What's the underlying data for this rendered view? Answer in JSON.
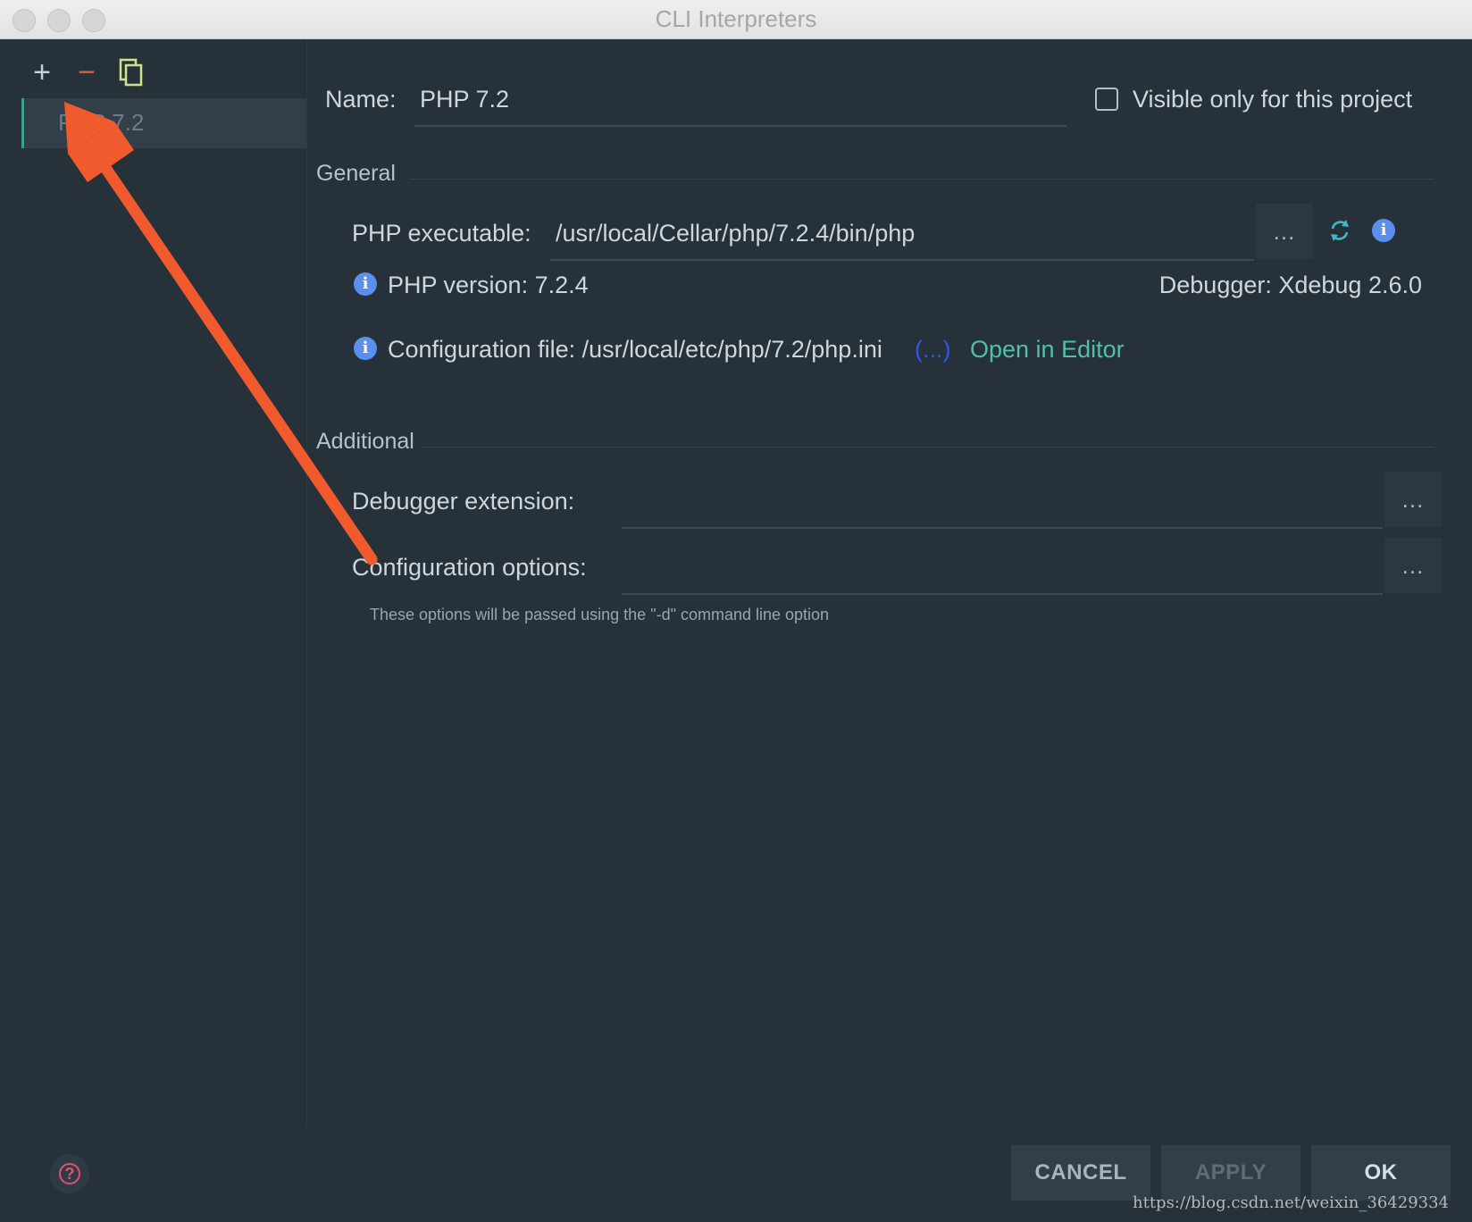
{
  "window": {
    "title": "CLI Interpreters"
  },
  "toolbar": {
    "add_icon": "plus-icon",
    "remove_icon": "minus-icon",
    "copy_icon": "copy-icon",
    "add_glyph": "+",
    "remove_glyph": "−"
  },
  "interpreters": [
    {
      "label": "PHP 7.2"
    }
  ],
  "form": {
    "name_label": "Name:",
    "name_value": "PHP 7.2",
    "visible_only_label": "Visible only for this project",
    "visible_only_checked": false,
    "general_section": "General",
    "php_executable_label": "PHP executable:",
    "php_executable_value": "/usr/local/Cellar/php/7.2.4/bin/php",
    "browse_label": "...",
    "php_version_text": "PHP version: 7.2.4",
    "debugger_text": "Debugger: Xdebug 2.6.0",
    "config_file_text": "Configuration file: /usr/local/etc/php/7.2/php.ini",
    "config_file_more": "(...)",
    "open_in_editor": "Open in Editor",
    "additional_section": "Additional",
    "debugger_extension_label": "Debugger extension:",
    "debugger_extension_value": "",
    "configuration_options_label": "Configuration options:",
    "configuration_options_value": "",
    "configuration_options_hint": "These options will be passed using the \"-d\" command line option"
  },
  "footer": {
    "help_glyph": "?",
    "cancel": "CANCEL",
    "apply": "APPLY",
    "ok": "OK"
  },
  "watermark": "https://blog.csdn.net/weixin_36429334",
  "colors": {
    "background": "#26313a",
    "accent_green": "#3aa38f",
    "link_teal": "#4fc1a6",
    "link_blue": "#2f57e6",
    "remove_red": "#e05a4a",
    "annotation_arrow": "#f05a2c"
  }
}
